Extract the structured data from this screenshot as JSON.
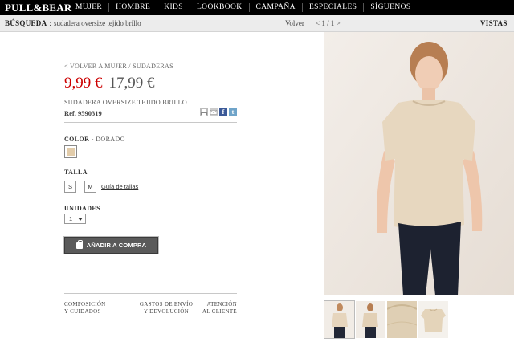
{
  "brand": {
    "logo": "PULL&BEAR"
  },
  "nav": {
    "items": [
      "MUJER",
      "HOMBRE",
      "KIDS",
      "LOOKBOOK",
      "CAMPAÑA",
      "ESPECIALES",
      "SÍGUENOS"
    ]
  },
  "search": {
    "label": "BÚSQUEDA",
    "separator": ":",
    "term": "sudadera oversize tejido brillo",
    "back": "Volver",
    "pager": "< 1 / 1 >",
    "views_label": "VISTAS"
  },
  "product": {
    "back_link": "< VOLVER A MUJER / SUDADERAS",
    "price_sale": "9,99 €",
    "price_old": "17,99 €",
    "name": "SUDADERA OVERSIZE TEJIDO BRILLO",
    "ref": "Ref. 9590319",
    "color_label": "COLOR",
    "color_value": "- DORADO",
    "color_swatch": "#e2ccaa",
    "size_label": "TALLA",
    "sizes": [
      "S",
      "M"
    ],
    "size_guide": "Guía de tallas",
    "units_label": "UNIDADES",
    "units_value": "1",
    "add_button": "AÑADIR A COMPRA"
  },
  "share": {
    "fb": "f",
    "tw": "t"
  },
  "footer": {
    "composition": [
      "COMPOSICIÓN",
      "Y CUIDADOS"
    ],
    "shipping": [
      "GASTOS DE ENVÍO",
      "Y DEVOLUCIÓN"
    ],
    "support": [
      "ATENCIÓN",
      "AL CLIENTE"
    ]
  },
  "icons": [
    "print-icon",
    "mail-icon",
    "facebook-icon",
    "twitter-icon",
    "bag-icon",
    "chevron-down-icon"
  ]
}
